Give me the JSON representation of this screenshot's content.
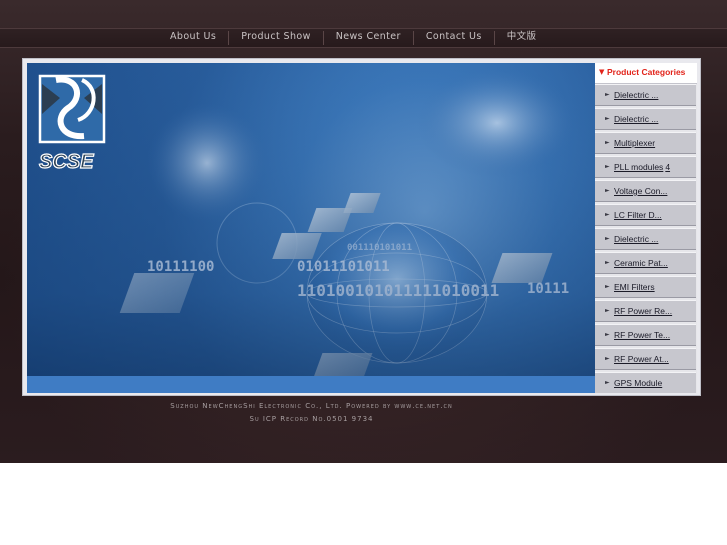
{
  "nav": {
    "items": [
      "About Us",
      "Product Show",
      "News Center",
      "Contact Us",
      "中文版"
    ]
  },
  "banner": {
    "logo_text": "SCSE",
    "binary": [
      "10111100",
      "01011101011",
      "110100101011111010011",
      "10111",
      "001110101011"
    ]
  },
  "sidebar": {
    "title": "Product Categories",
    "items": [
      {
        "label": "Dielectric ..."
      },
      {
        "label": "Dielectric ..."
      },
      {
        "label": "Multiplexer"
      },
      {
        "label": "PLL modules",
        "count": "4"
      },
      {
        "label": "Voltage Con..."
      },
      {
        "label": "LC Filter D..."
      },
      {
        "label": "Dielectric ..."
      },
      {
        "label": "Ceramic Pat..."
      },
      {
        "label": "EMI Filters"
      },
      {
        "label": "RF Power Re..."
      },
      {
        "label": "RF Power Te..."
      },
      {
        "label": "RF Power At..."
      },
      {
        "label": "GPS Module"
      }
    ]
  },
  "footer": {
    "line1": "Suzhou NewChengShi Electronic Co., Ltd.  Powered by www.ce.net.cn",
    "line2": "Su ICP Record No.0501 9734"
  },
  "colors": {
    "accent": "#e2231a",
    "banner_blue": "#3b77b9",
    "sidebar_item": "#c7c7ce"
  }
}
